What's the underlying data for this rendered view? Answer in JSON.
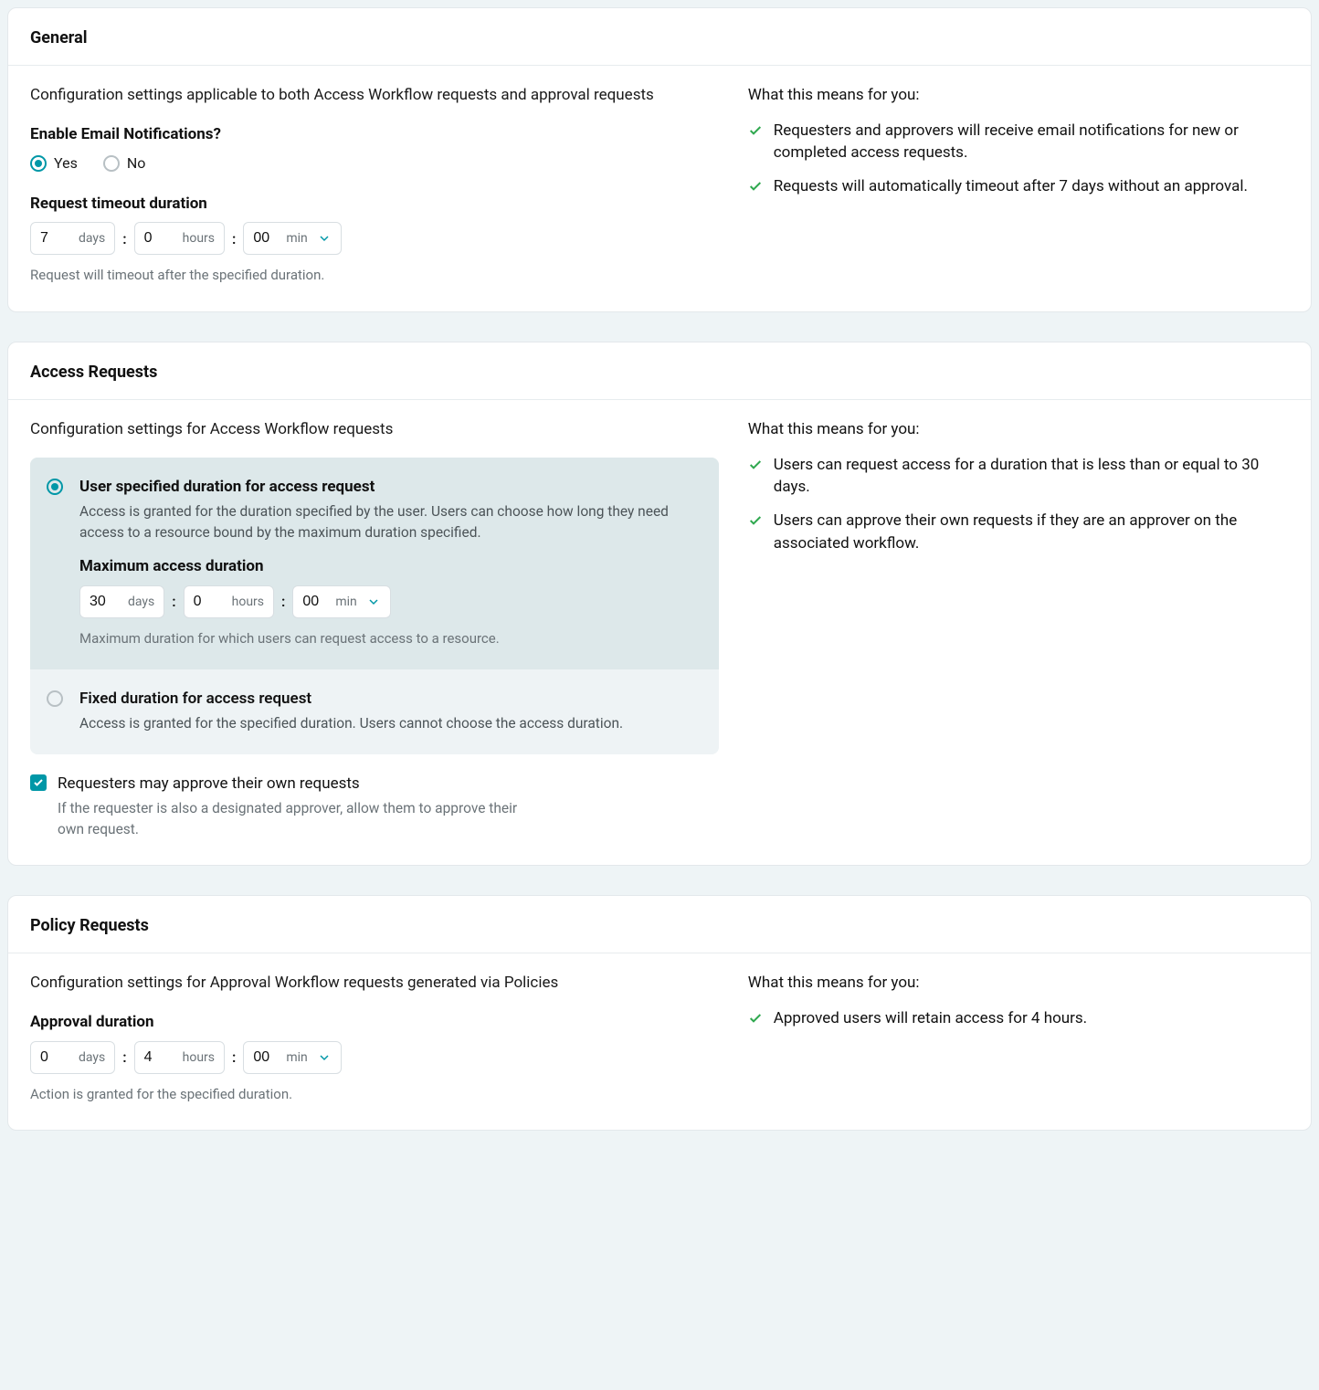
{
  "general": {
    "title": "General",
    "desc": "Configuration settings applicable to both Access Workflow requests and approval requests",
    "emailLabel": "Enable Email Notifications?",
    "yes": "Yes",
    "no": "No",
    "timeoutLabel": "Request timeout duration",
    "timeout": {
      "days": "7",
      "hours": "0",
      "mins": "00",
      "daysUnit": "days",
      "hoursUnit": "hours",
      "minsUnit": "min"
    },
    "timeoutHelper": "Request will timeout after the specified duration.",
    "meansTitle": "What this means for you:",
    "means": [
      "Requesters and approvers will receive email notifications for new or completed access requests.",
      "Requests will automatically timeout after 7 days without an approval."
    ]
  },
  "access": {
    "title": "Access Requests",
    "desc": "Configuration settings for Access Workflow requests",
    "opt1": {
      "title": "User specified duration for access request",
      "desc": "Access is granted for the duration specified by the user. Users can choose how long they need access to a resource bound by the maximum duration specified.",
      "maxLabel": "Maximum access duration",
      "max": {
        "days": "30",
        "hours": "0",
        "mins": "00",
        "daysUnit": "days",
        "hoursUnit": "hours",
        "minsUnit": "min"
      },
      "maxHelper": "Maximum duration for which users can request access to a resource."
    },
    "opt2": {
      "title": "Fixed duration for access request",
      "desc": "Access is granted for the specified duration. Users cannot choose the access duration."
    },
    "selfApprove": {
      "label": "Requesters may approve their own requests",
      "desc": "If the requester is also a designated approver, allow them to approve their own request."
    },
    "meansTitle": "What this means for you:",
    "means": [
      "Users can request access for a duration that is less than or equal to 30 days.",
      "Users can approve their own requests if they are an approver on the associated workflow."
    ]
  },
  "policy": {
    "title": "Policy Requests",
    "desc": "Configuration settings for Approval Workflow requests generated via Policies",
    "durLabel": "Approval duration",
    "dur": {
      "days": "0",
      "hours": "4",
      "mins": "00",
      "daysUnit": "days",
      "hoursUnit": "hours",
      "minsUnit": "min"
    },
    "durHelper": "Action is granted for the specified duration.",
    "meansTitle": "What this means for you:",
    "means": [
      "Approved users will retain access for 4 hours."
    ]
  }
}
